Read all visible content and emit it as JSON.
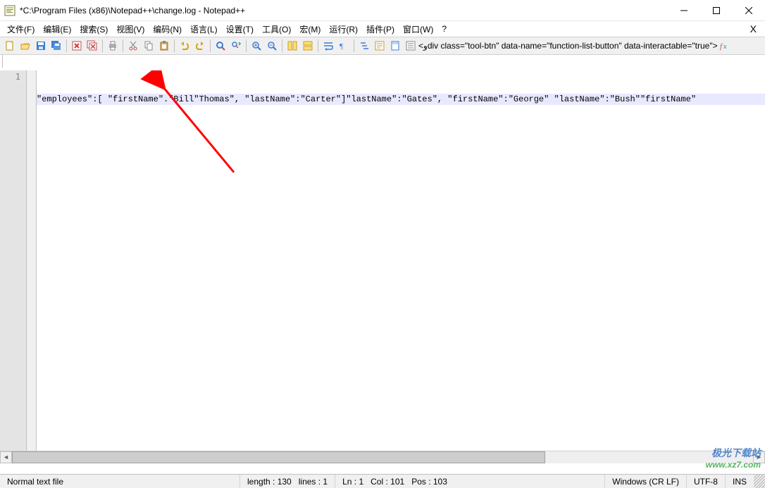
{
  "window": {
    "title": "*C:\\Program Files (x86)\\Notepad++\\change.log - Notepad++"
  },
  "menu": {
    "items": [
      "文件(F)",
      "编辑(E)",
      "搜索(S)",
      "视图(V)",
      "编码(N)",
      "语言(L)",
      "设置(T)",
      "工具(O)",
      "宏(M)",
      "运行(R)",
      "插件(P)",
      "窗口(W)",
      "?"
    ]
  },
  "toolbar": {
    "groups": [
      [
        "new-file",
        "open-file",
        "save-file",
        "save-all"
      ],
      [
        "close-file",
        "close-all"
      ],
      [
        "print"
      ],
      [
        "cut",
        "copy",
        "paste"
      ],
      [
        "undo",
        "redo"
      ],
      [
        "find",
        "replace"
      ],
      [
        "zoom-in",
        "zoom-out"
      ],
      [
        "sync-v",
        "sync-h"
      ],
      [
        "word-wrap",
        "show-all-chars"
      ],
      [
        "indent-guide",
        "lang-panel",
        "doc-map",
        "doc-list",
        "func-list"
      ],
      [
        "folder-workspace",
        "monitor"
      ],
      [
        "record-macro",
        "stop-macro",
        "play-macro",
        "play-multi",
        "save-macro"
      ],
      [
        "char-panel"
      ]
    ]
  },
  "tabs": {
    "items": [
      {
        "label": "change.log",
        "modified": true
      }
    ]
  },
  "editor": {
    "line_number": "1",
    "content": "\"employees\":[ \"firstName\".\"Bill\"Thomas\", \"lastName\":\"Carter\"]\"lastName\":\"Gates\", \"firstName\":\"George\" \"lastName\":\"Bush\"\"firstName\""
  },
  "statusbar": {
    "file_type": "Normal text file",
    "length_label": "length : 130",
    "lines_label": "lines : 1",
    "ln_label": "Ln : 1",
    "col_label": "Col : 101",
    "pos_label": "Pos : 103",
    "eol": "Windows (CR LF)",
    "encoding": "UTF-8",
    "ins": "INS"
  },
  "watermark": {
    "line1": "极光下载站",
    "line2": "www.xz7.com"
  }
}
